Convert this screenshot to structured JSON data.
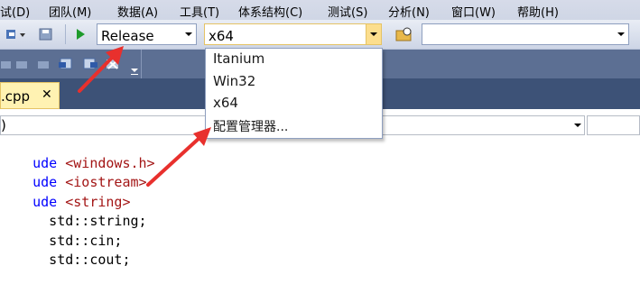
{
  "menubar": {
    "items": [
      "试(D)",
      "团队(M)",
      "数据(A)",
      "工具(T)",
      "体系结构(C)",
      "测试(S)",
      "分析(N)",
      "窗口(W)",
      "帮助(H)"
    ]
  },
  "toolbar": {
    "config_value": "Release",
    "platform_value": "x64",
    "find_value": ""
  },
  "platform_dropdown": {
    "options": [
      "Itanium",
      "Win32",
      "x64",
      "配置管理器..."
    ]
  },
  "tabs": [
    {
      "label": ".cpp",
      "close": "✕"
    }
  ],
  "navbar": {
    "left_text": ")"
  },
  "editor": {
    "lines": [
      {
        "kw": "ude",
        "rest": " <windows.h>"
      },
      {
        "kw": "ude",
        "rest": " <iostream>"
      },
      {
        "kw": "ude",
        "rest": " <string>"
      },
      {
        "kw": "",
        "rest": "  std::string;"
      },
      {
        "kw": "",
        "rest": "  std::cin;"
      },
      {
        "kw": "",
        "rest": "  std::cout;"
      }
    ]
  },
  "colors": {
    "annotation_arrow": "#e8302d",
    "menubar_bg": "#d6dbe9",
    "tabstrip_bg": "#3d5277",
    "active_tab_bg": "#fff2b2",
    "keyword": "#0000ff",
    "string": "#a31515"
  }
}
